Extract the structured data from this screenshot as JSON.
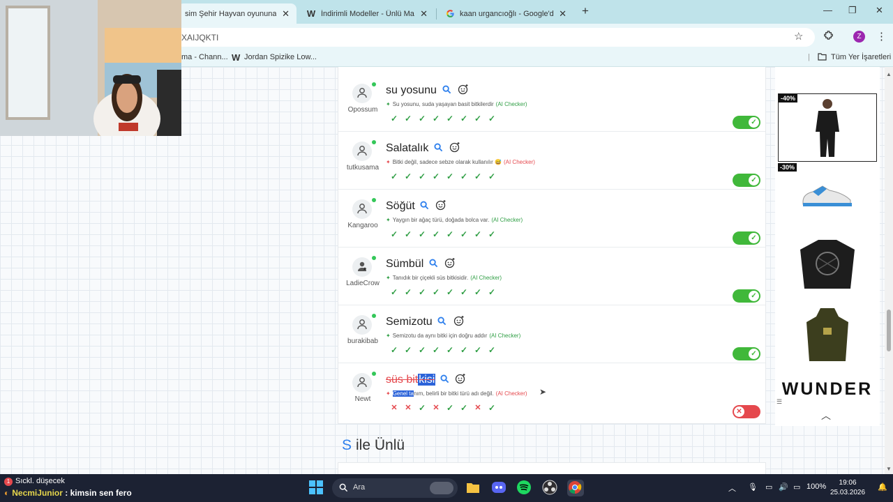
{
  "browser": {
    "tabs": [
      {
        "title": "sim Şehir Hayvan oyununa kat",
        "icon": "game-tab-icon",
        "active": true
      },
      {
        "title": "İndirimli Modeller - Ünlü Marka",
        "icon": "w-logo-icon",
        "active": false
      },
      {
        "title": "kaan urgancıoğlı - Google'da A",
        "icon": "google-icon",
        "active": false
      }
    ],
    "address": "XAIJQKTI",
    "bookmarks": [
      {
        "label": "ma - Chann..."
      },
      {
        "label": "Jordan Spizike Low..."
      }
    ],
    "all_bookmarks": "Tüm Yer İşaretleri",
    "profile_initial": "Z"
  },
  "entries": [
    {
      "user": "Opossum",
      "word": "su yosunu",
      "note": "Su yosunu, suda yaşayan basit bitkilerdir",
      "ai": "(AI Checker)",
      "valid": true,
      "votes": [
        "ok",
        "ok",
        "ok",
        "ok",
        "ok",
        "ok",
        "ok",
        "ok"
      ]
    },
    {
      "user": "tutkusama",
      "word": "Salatalık",
      "note": "Bitki değil, sadece sebze olarak kullanılır 😅",
      "ai": "(AI Checker)",
      "valid": true,
      "votes": [
        "ok",
        "ok",
        "ok",
        "ok",
        "ok",
        "ok",
        "ok",
        "ok"
      ]
    },
    {
      "user": "Kangaroo",
      "word": "Söğüt",
      "note": "Yaygın bir ağaç türü, doğada bolca var.",
      "ai": "(AI Checker)",
      "valid": true,
      "votes": [
        "ok",
        "ok",
        "ok",
        "ok",
        "ok",
        "ok",
        "ok",
        "ok"
      ]
    },
    {
      "user": "LadieCrow",
      "word": "Sümbül",
      "note": "Tanıdık bir çiçekli süs bitkisidir.",
      "ai": "(AI Checker)",
      "valid": true,
      "votes": [
        "ok",
        "ok",
        "ok",
        "ok",
        "ok",
        "ok",
        "ok",
        "ok"
      ]
    },
    {
      "user": "burakibab",
      "word": "Semizotu",
      "note": "Semizotu da aynı bitki için doğru addır",
      "ai": "(AI Checker)",
      "valid": true,
      "votes": [
        "ok",
        "ok",
        "ok",
        "ok",
        "ok",
        "ok",
        "ok",
        "ok"
      ]
    },
    {
      "user": "Newt",
      "word_a": "süs bit",
      "word_b": "kisi",
      "note_a": "Genel ta",
      "note_b": "nım, belirli bir bitki türü adı değil.",
      "ai": "(AI Checker)",
      "valid": false,
      "votes": [
        "no",
        "no",
        "ok",
        "no",
        "ok",
        "ok",
        "no",
        "ok"
      ]
    }
  ],
  "section": {
    "accent": "S",
    "title": "ile Ünlü"
  },
  "ad": {
    "badge1": "-40%",
    "badge2": "-30%",
    "brand": "WUNDER"
  },
  "taskbar": {
    "notif_title": "Sıckl. düşecek",
    "notif_nick": "NecmiJunior",
    "notif_msg": ": kimsin sen fero",
    "search": "Ara",
    "battery": "100%",
    "time": "19:06",
    "date": "25.03.2026"
  }
}
